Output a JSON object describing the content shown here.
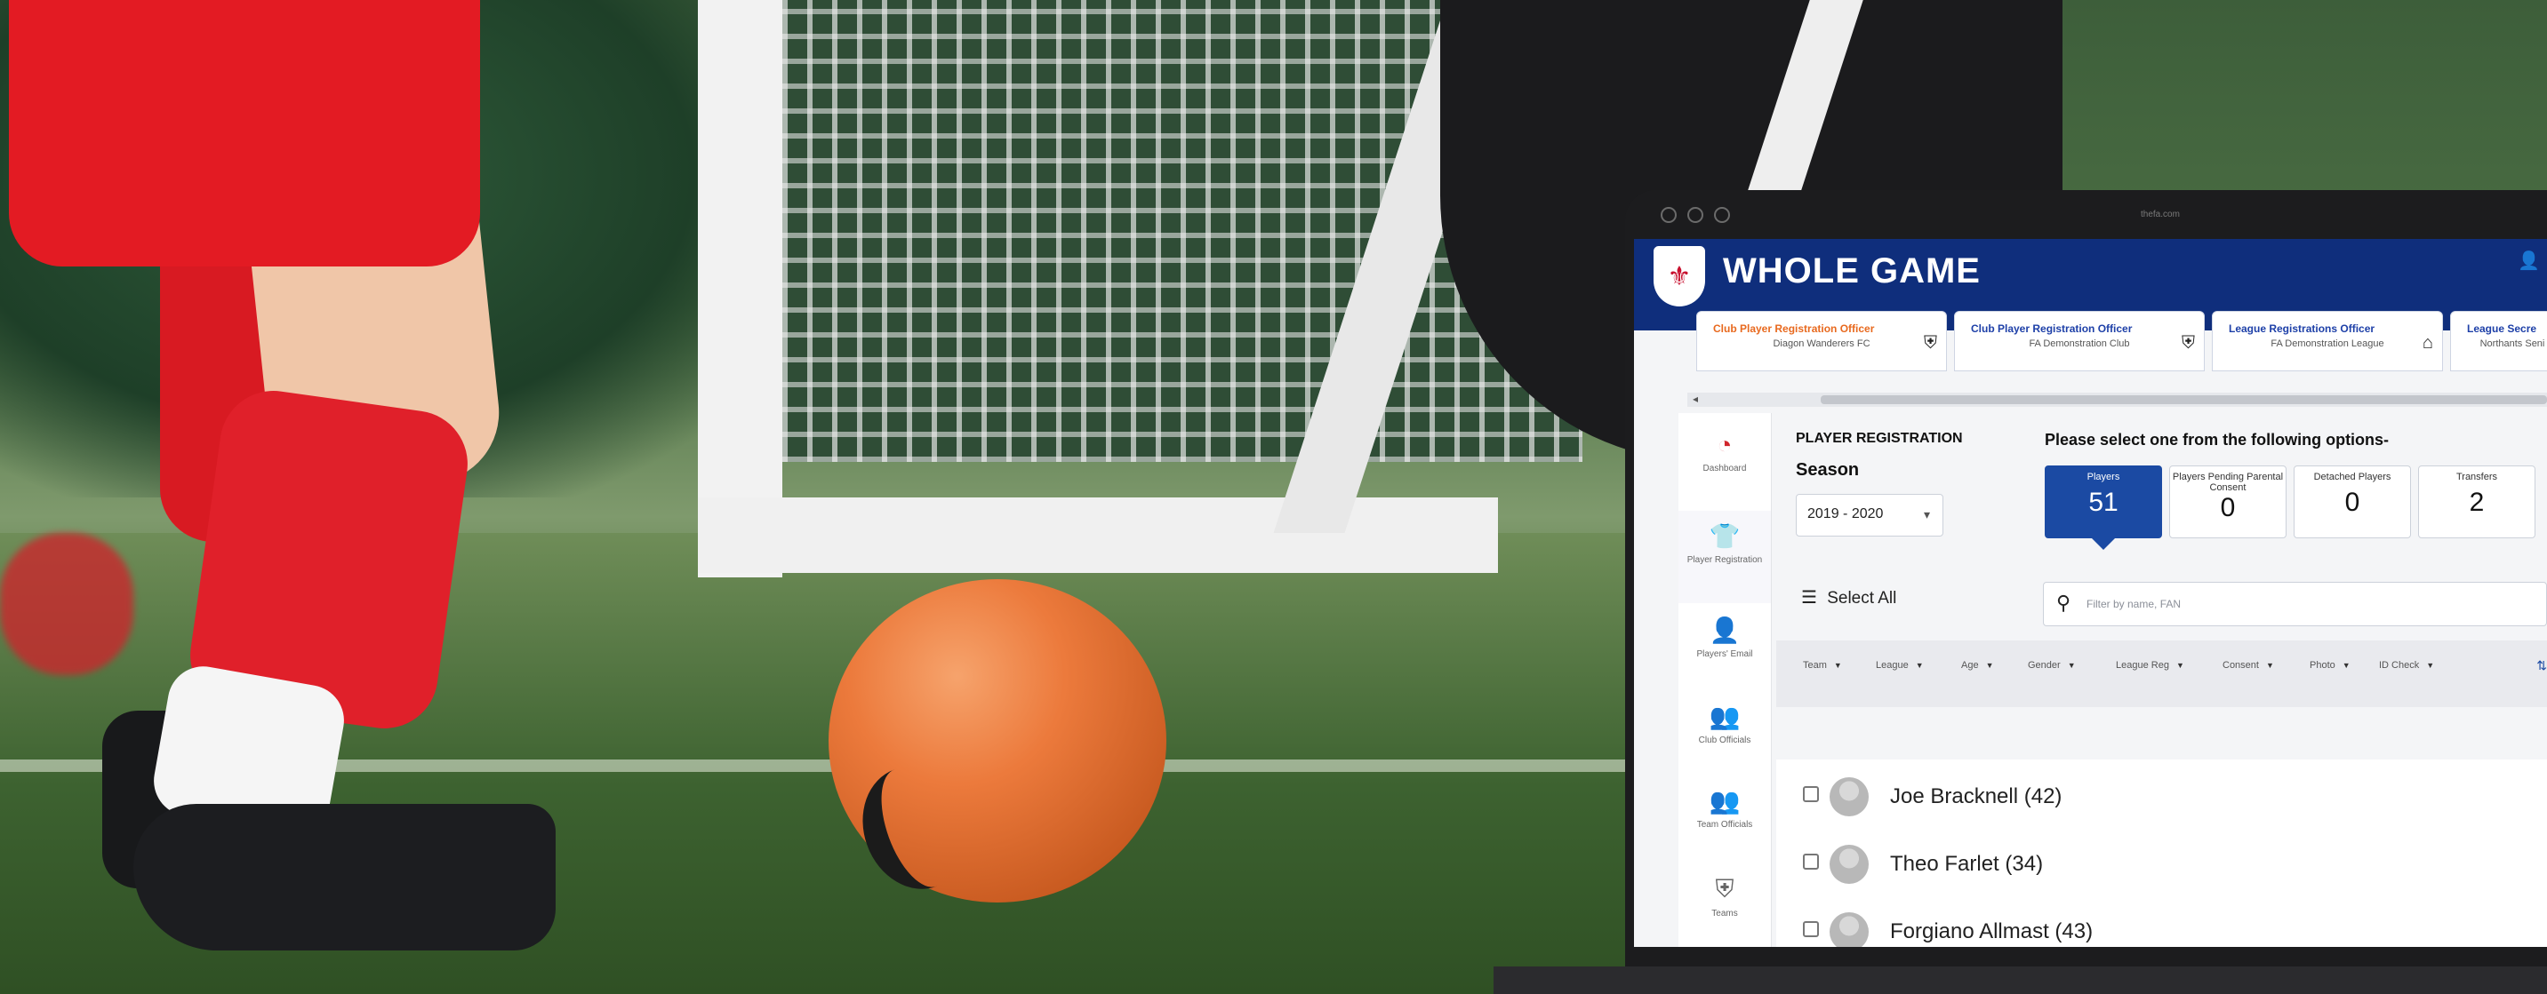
{
  "app": {
    "brand": "WHOLE GAME",
    "url": "thefa.com"
  },
  "tabs": [
    {
      "role": "Club Player Registration Officer",
      "org": "Diagon Wanderers FC",
      "active": true
    },
    {
      "role": "Club Player Registration Officer",
      "org": "FA Demonstration Club",
      "active": false
    },
    {
      "role": "League Registrations Officer",
      "org": "FA Demonstration League",
      "active": false
    },
    {
      "role": "League Secre",
      "org": "Northants Seni",
      "active": false
    }
  ],
  "sidebar": {
    "items": [
      {
        "label": "Dashboard",
        "icon": "dashboard-icon"
      },
      {
        "label": "Player Registration",
        "icon": "player-shirt-icon",
        "active": true
      },
      {
        "label": "Players' Email",
        "icon": "add-user-icon"
      },
      {
        "label": "Club Officials",
        "icon": "group-icon"
      },
      {
        "label": "Team Officials",
        "icon": "team-group-icon"
      },
      {
        "label": "Teams",
        "icon": "shield-icon"
      }
    ]
  },
  "registration": {
    "section_title": "PLAYER REGISTRATION",
    "season_label": "Season",
    "season_value": "2019 - 2020",
    "options_title": "Please select one from the following options-",
    "options": [
      {
        "label": "Players",
        "value": "51",
        "selected": true
      },
      {
        "label": "Players Pending Parental Consent",
        "value": "0"
      },
      {
        "label": "Detached Players",
        "value": "0"
      },
      {
        "label": "Transfers",
        "value": "2"
      }
    ],
    "select_all": "Select All",
    "filter_placeholder": "Filter by name, FAN",
    "columns": [
      "Team",
      "League",
      "Age",
      "Gender",
      "League Reg",
      "Consent",
      "Photo",
      "ID Check"
    ],
    "players": [
      {
        "name": "Joe Bracknell (42)"
      },
      {
        "name": "Theo Farlet (34)"
      },
      {
        "name": "Forgiano Allmast (43)"
      }
    ]
  },
  "colors": {
    "header_blue": "#0f2e7c",
    "selected_option": "#1b4aa3",
    "active_tab_orange": "#e8691e"
  }
}
